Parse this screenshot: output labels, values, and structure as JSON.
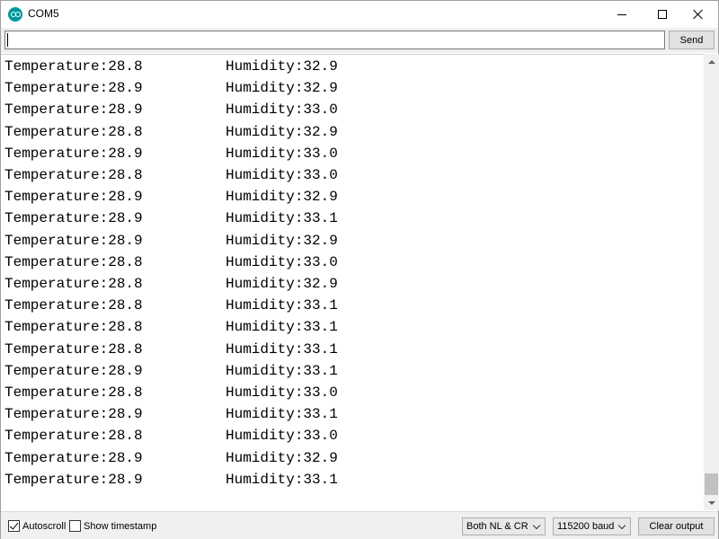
{
  "window": {
    "title": "COM5"
  },
  "input": {
    "value": "",
    "send_label": "Send"
  },
  "output_lines": [
    {
      "temperature": "Temperature:28.8",
      "humidity": "Humidity:32.9"
    },
    {
      "temperature": "Temperature:28.9",
      "humidity": "Humidity:32.9"
    },
    {
      "temperature": "Temperature:28.9",
      "humidity": "Humidity:33.0"
    },
    {
      "temperature": "Temperature:28.8",
      "humidity": "Humidity:32.9"
    },
    {
      "temperature": "Temperature:28.9",
      "humidity": "Humidity:33.0"
    },
    {
      "temperature": "Temperature:28.8",
      "humidity": "Humidity:33.0"
    },
    {
      "temperature": "Temperature:28.9",
      "humidity": "Humidity:32.9"
    },
    {
      "temperature": "Temperature:28.9",
      "humidity": "Humidity:33.1"
    },
    {
      "temperature": "Temperature:28.9",
      "humidity": "Humidity:32.9"
    },
    {
      "temperature": "Temperature:28.8",
      "humidity": "Humidity:33.0"
    },
    {
      "temperature": "Temperature:28.8",
      "humidity": "Humidity:32.9"
    },
    {
      "temperature": "Temperature:28.8",
      "humidity": "Humidity:33.1"
    },
    {
      "temperature": "Temperature:28.8",
      "humidity": "Humidity:33.1"
    },
    {
      "temperature": "Temperature:28.8",
      "humidity": "Humidity:33.1"
    },
    {
      "temperature": "Temperature:28.9",
      "humidity": "Humidity:33.1"
    },
    {
      "temperature": "Temperature:28.8",
      "humidity": "Humidity:33.0"
    },
    {
      "temperature": "Temperature:28.9",
      "humidity": "Humidity:33.1"
    },
    {
      "temperature": "Temperature:28.8",
      "humidity": "Humidity:33.0"
    },
    {
      "temperature": "Temperature:28.9",
      "humidity": "Humidity:32.9"
    },
    {
      "temperature": "Temperature:28.9",
      "humidity": "Humidity:33.1"
    }
  ],
  "footer": {
    "autoscroll_label": "Autoscroll",
    "autoscroll_checked": true,
    "timestamp_label": "Show timestamp",
    "timestamp_checked": false,
    "line_ending": "Both NL & CR",
    "baud_rate": "115200 baud",
    "clear_label": "Clear output"
  },
  "colors": {
    "arduino_teal": "#00979c"
  }
}
